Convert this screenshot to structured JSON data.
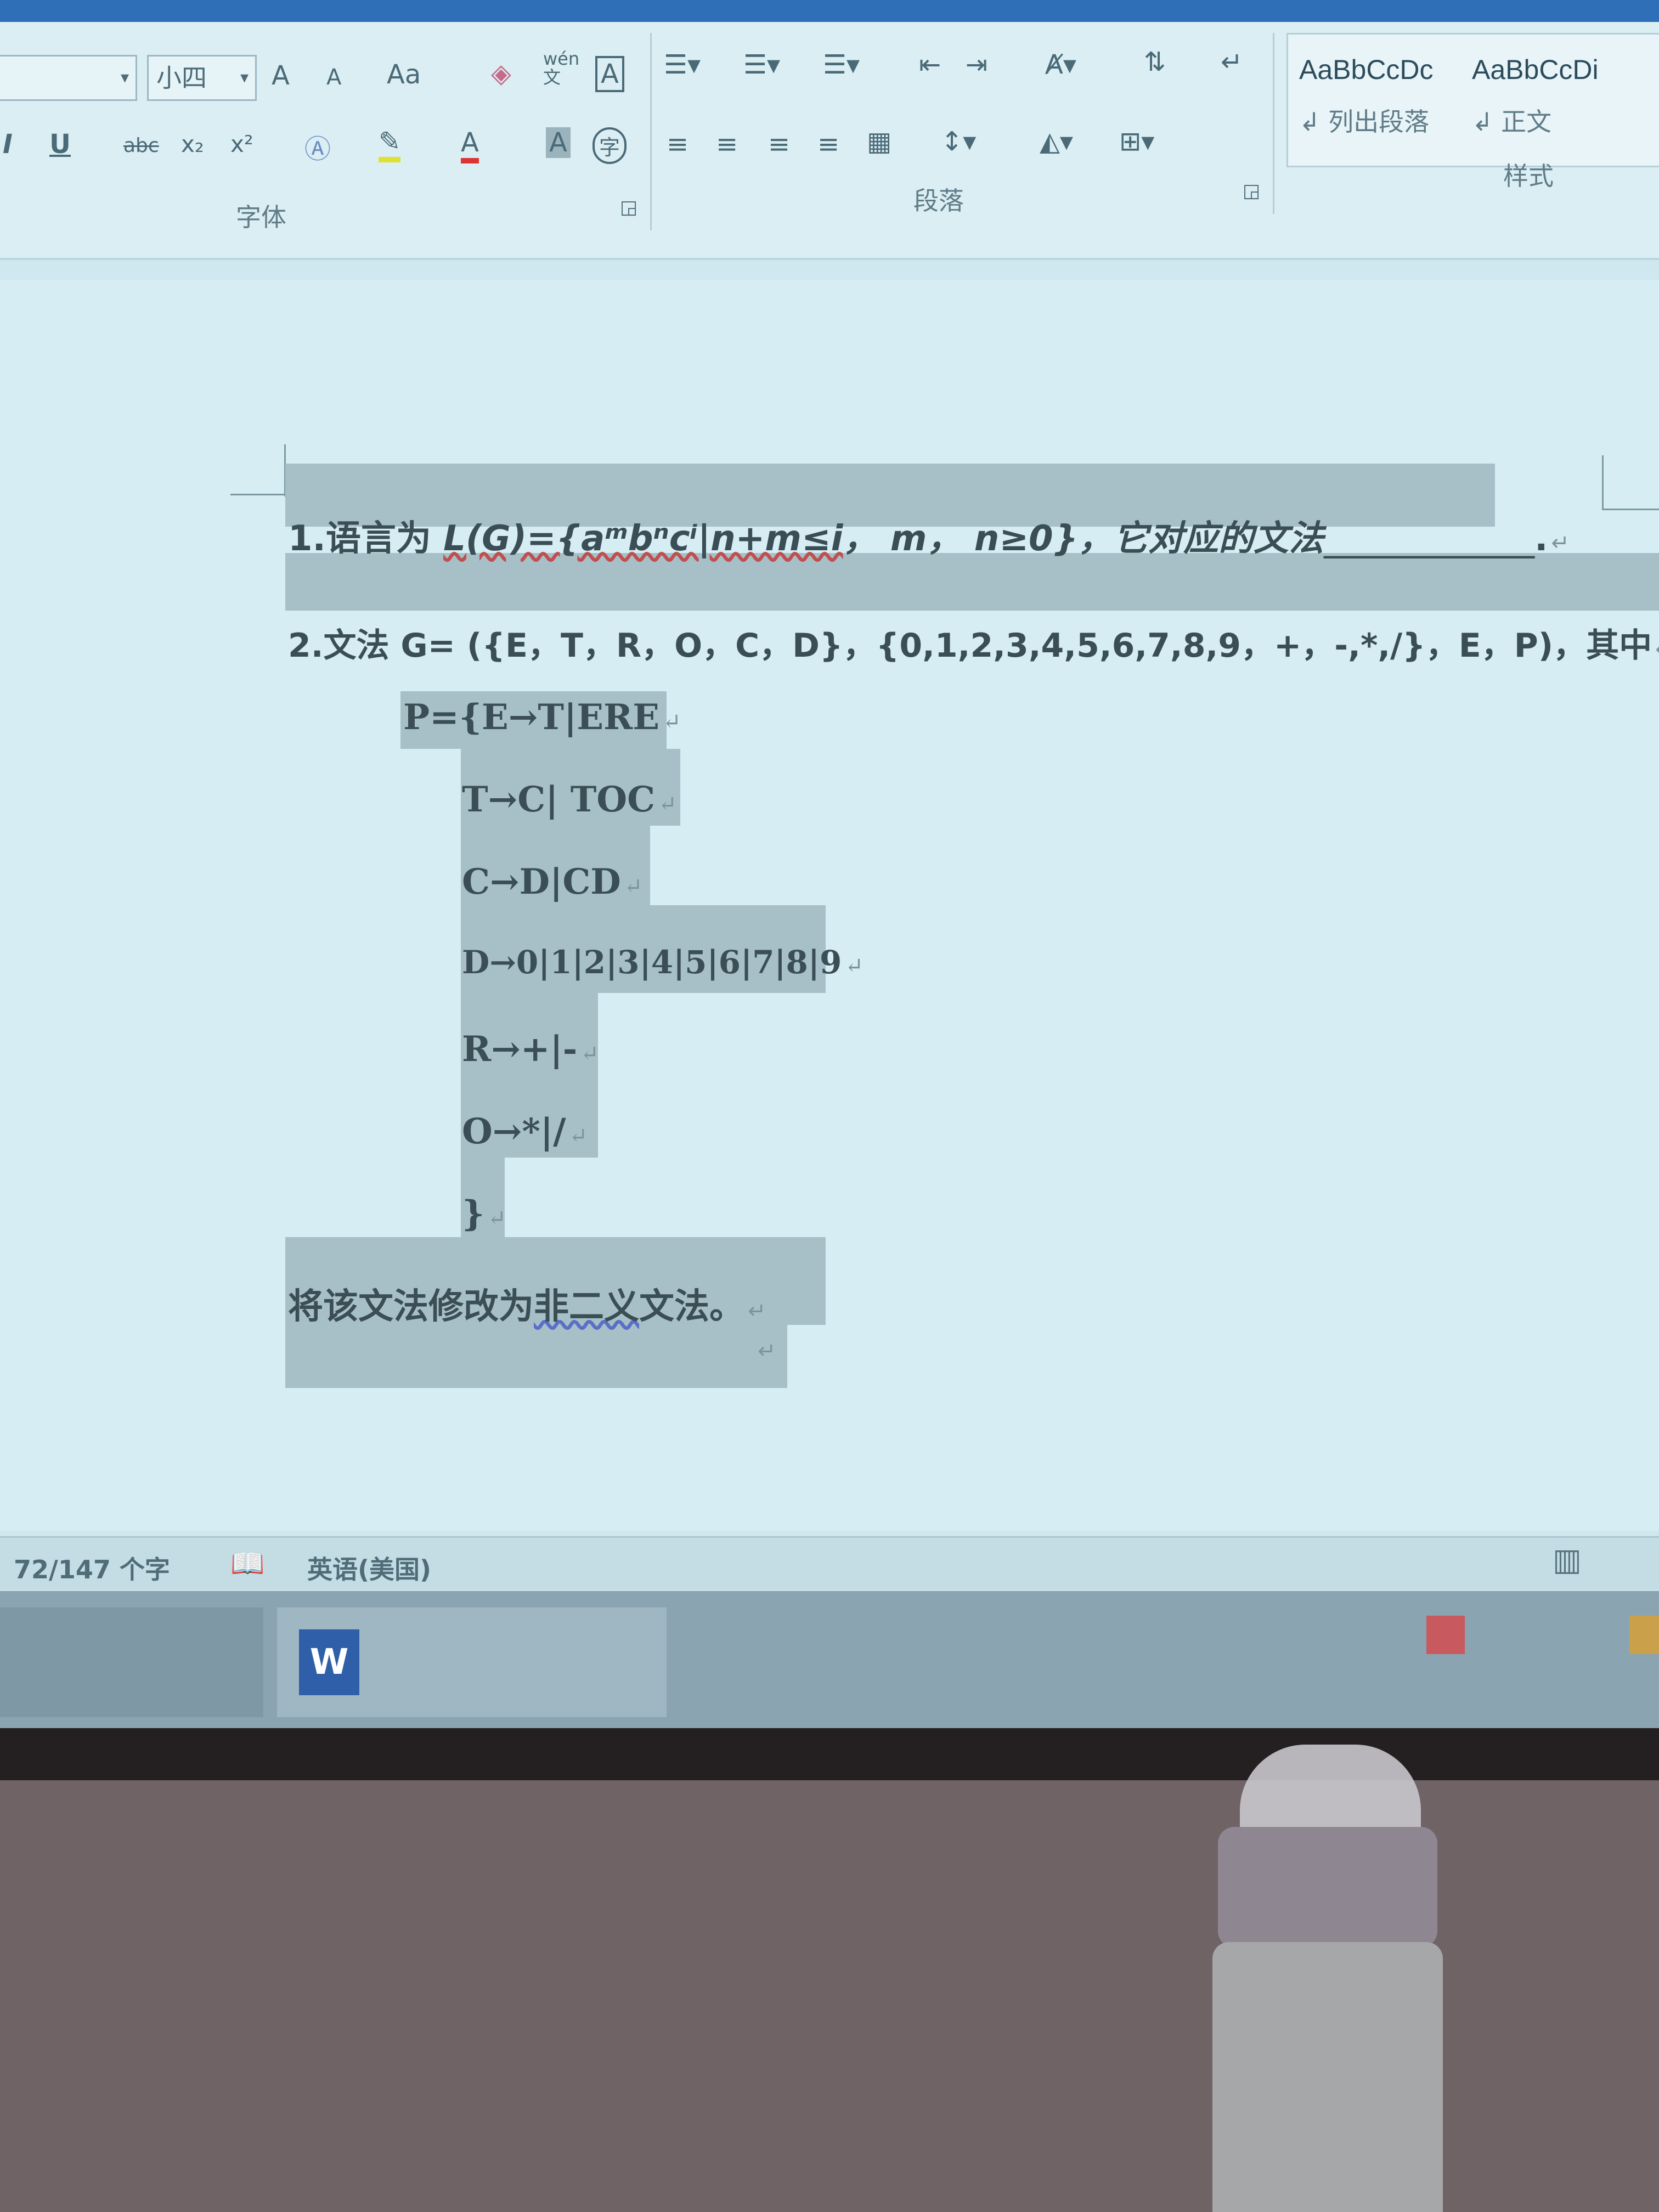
{
  "ribbon": {
    "font_size_value": "小四",
    "buttons": {
      "grow_font": "A",
      "shrink_font": "A",
      "change_case": "Aa",
      "phonetic": "wén\n文",
      "char_border": "A",
      "italic": "I",
      "underline": "U",
      "strikethrough": "abc",
      "subscript": "x₂",
      "superscript": "x²",
      "font_color": "A",
      "char_shading": "A",
      "enclose": "字"
    },
    "groups": {
      "font": "字体",
      "paragraph": "段落",
      "styles": "样式"
    },
    "styles": [
      {
        "preview": "AaBbCcDc",
        "name": "列出段落"
      },
      {
        "preview": "AaBbCcDi",
        "name": "正文"
      }
    ]
  },
  "document": {
    "q1": {
      "prefix": "1.语言为 ",
      "formula": "L(G)={aᵐbⁿcⁱ|n+m≤i",
      "rest": "， m， n≥0}，它对应的文法",
      "blank": "____________",
      "end": "."
    },
    "q2": "2.文法 G= ({E，T，R，O，C，D}，{0,1,2,3,4,5,6,7,8,9，+，-,*,/}，E，P)，其中",
    "productions": [
      "P={E→T|ERE",
      "T→C| TOC",
      "C→D|CD",
      "D→0|1|2|3|4|5|6|7|8|9",
      "R→+|-",
      "O→*|/",
      "}"
    ],
    "task_prefix": "将该文法修改为",
    "task_underlined": "非二义",
    "task_suffix": "文法。",
    "paragraph_mark": "↵"
  },
  "statusbar": {
    "word_count": "72/147 个字",
    "language": "英语(美国)"
  },
  "taskbar": {
    "word_app_letter": "W"
  }
}
